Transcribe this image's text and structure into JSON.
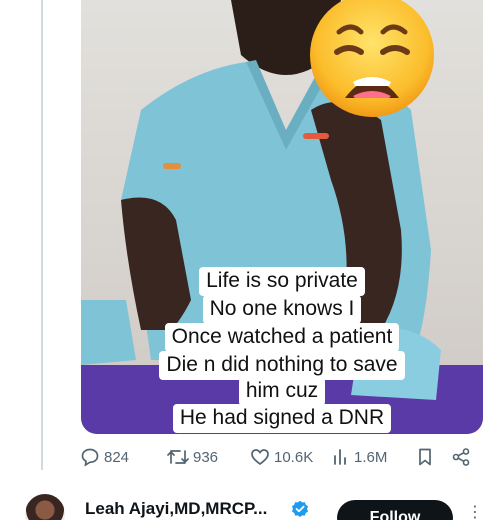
{
  "media": {
    "caption_lines": [
      "Life is so private",
      "No one knows I",
      "Once watched a patient",
      "Die n did nothing to save",
      "him cuz",
      "He had signed a DNR"
    ]
  },
  "actions": {
    "replies": "824",
    "reposts": "936",
    "likes": "10.6K",
    "views": "1.6M"
  },
  "author": {
    "name": "Leah Ajayi,MD,MRCP...",
    "follow_label": "Follow",
    "more_label": "⋮"
  },
  "colors": {
    "scrubs": "#7ec3d6",
    "text_muted": "#536471",
    "verified": "#1d9bf0",
    "follow_bg": "#0f1419"
  },
  "icons": [
    "reply-icon",
    "repost-icon",
    "like-icon",
    "views-icon",
    "bookmark-icon",
    "share-icon",
    "verified-icon",
    "more-icon"
  ]
}
